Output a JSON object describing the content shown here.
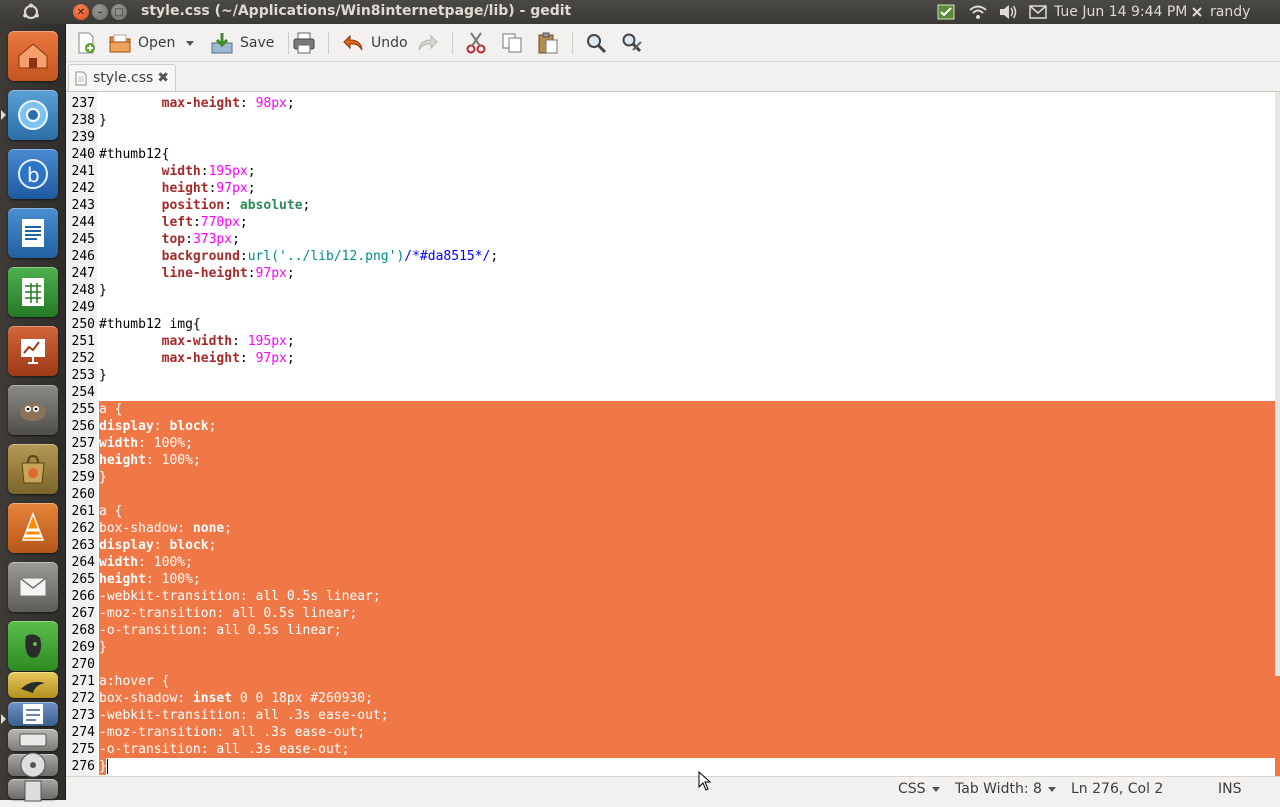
{
  "top_panel": {
    "window_title": "style.css (~/Applications/Win8internetpage/lib) - gedit",
    "clock": "Tue Jun 14  9:44 PM",
    "user": "randy"
  },
  "toolbar": {
    "open_label": "Open",
    "save_label": "Save",
    "undo_label": "Undo"
  },
  "tab": {
    "label": "style.css",
    "close": "✖"
  },
  "editor": {
    "lines": [
      {
        "n": "237",
        "html": "        <span class='prop'>max-height</span>: <span class='num'>98px</span>;"
      },
      {
        "n": "238",
        "html": "}"
      },
      {
        "n": "239",
        "html": ""
      },
      {
        "n": "240",
        "html": "#thumb12{"
      },
      {
        "n": "241",
        "html": "        <span class='prop'>width</span>:<span class='num'>195px</span>;"
      },
      {
        "n": "242",
        "html": "        <span class='prop'>height</span>:<span class='num'>97px</span>;"
      },
      {
        "n": "243",
        "html": "        <span class='prop'>position</span>: <span class='kw'>absolute</span>;"
      },
      {
        "n": "244",
        "html": "        <span class='prop'>left</span>:<span class='num'>770px</span>;"
      },
      {
        "n": "245",
        "html": "        <span class='prop'>top</span>:<span class='num'>373px</span>;"
      },
      {
        "n": "246",
        "html": "        <span class='prop'>background</span>:<span class='url'>url('../lib/12.png')</span><span class='cmt'>/*#da8515*/</span>;"
      },
      {
        "n": "247",
        "html": "        <span class='prop'>line-height</span>:<span class='num'>97px</span>;"
      },
      {
        "n": "248",
        "html": "}"
      },
      {
        "n": "249",
        "html": ""
      },
      {
        "n": "250",
        "html": "#thumb12 img{"
      },
      {
        "n": "251",
        "html": "        <span class='prop'>max-width</span>: <span class='num'>195px</span>;"
      },
      {
        "n": "252",
        "html": "        <span class='prop'>max-height</span>: <span class='num'>97px</span>;"
      },
      {
        "n": "253",
        "html": "}"
      },
      {
        "n": "254",
        "html": ""
      },
      {
        "n": "255",
        "sel": true,
        "html": "a {"
      },
      {
        "n": "256",
        "sel": true,
        "html": "<b>display</b>: <b>block</b>;"
      },
      {
        "n": "257",
        "sel": true,
        "html": "<b>width</b>: 100%;"
      },
      {
        "n": "258",
        "sel": true,
        "html": "<b>height</b>: 100%;"
      },
      {
        "n": "259",
        "sel": true,
        "html": "}"
      },
      {
        "n": "260",
        "sel": true,
        "html": ""
      },
      {
        "n": "261",
        "sel": true,
        "html": "a {"
      },
      {
        "n": "262",
        "sel": true,
        "html": "box-shadow: <b>none</b>;"
      },
      {
        "n": "263",
        "sel": true,
        "html": "<b>display</b>: <b>block</b>;"
      },
      {
        "n": "264",
        "sel": true,
        "html": "<b>width</b>: 100%;"
      },
      {
        "n": "265",
        "sel": true,
        "html": "<b>height</b>: 100%;"
      },
      {
        "n": "266",
        "sel": true,
        "html": "-webkit-transition: all 0.5s linear;"
      },
      {
        "n": "267",
        "sel": true,
        "html": "-moz-transition: all 0.5s linear;"
      },
      {
        "n": "268",
        "sel": true,
        "html": "-o-transition: all 0.5s linear;"
      },
      {
        "n": "269",
        "sel": true,
        "html": "}"
      },
      {
        "n": "270",
        "sel": true,
        "html": ""
      },
      {
        "n": "271",
        "sel": true,
        "html": "a:hover {"
      },
      {
        "n": "272",
        "sel": true,
        "html": "box-shadow: <b>inset</b> 0 0 18px #260930;"
      },
      {
        "n": "273",
        "sel": true,
        "html": "-webkit-transition: all .3s ease-out;"
      },
      {
        "n": "274",
        "sel": true,
        "html": "-moz-transition: all .3s ease-out;"
      },
      {
        "n": "275",
        "sel": true,
        "html": "-o-transition: all .3s ease-out;"
      },
      {
        "n": "276",
        "sel": "partial",
        "html": "}"
      }
    ]
  },
  "statusbar": {
    "language": "CSS",
    "tab_width": "Tab Width:  8",
    "position": "Ln 276, Col 2",
    "mode": "INS"
  },
  "colors": {
    "selection": "#f07746",
    "panel": "#3c3b37"
  }
}
